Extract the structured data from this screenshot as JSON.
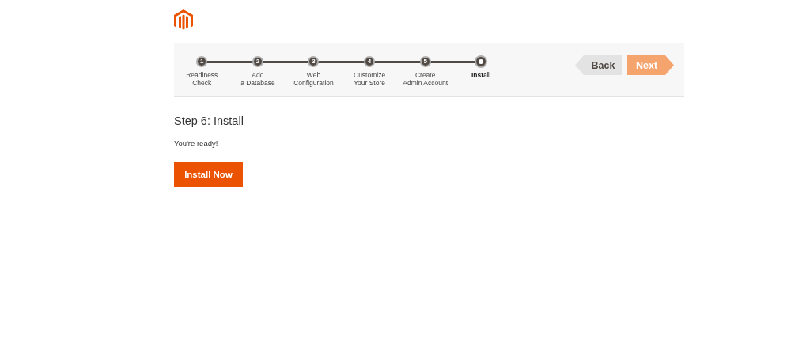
{
  "steps": [
    {
      "number": "1",
      "label": [
        "Readiness",
        "Check"
      ],
      "selected": false
    },
    {
      "number": "2",
      "label": [
        "Add",
        "a Database"
      ],
      "selected": false
    },
    {
      "number": "3",
      "label": [
        "Web",
        "Configuration"
      ],
      "selected": false
    },
    {
      "number": "4",
      "label": [
        "Customize",
        "Your Store"
      ],
      "selected": false
    },
    {
      "number": "5",
      "label": [
        "Create",
        "Admin Account"
      ],
      "selected": false
    },
    {
      "label": [
        "Install"
      ],
      "selected": true
    }
  ],
  "back_button": {
    "label": "Back",
    "disabled": false
  },
  "next_button": {
    "label": "Next",
    "disabled": true
  },
  "heading": "Step 6: Install",
  "message": "You're ready!",
  "install_button": {
    "label": "Install Now"
  }
}
